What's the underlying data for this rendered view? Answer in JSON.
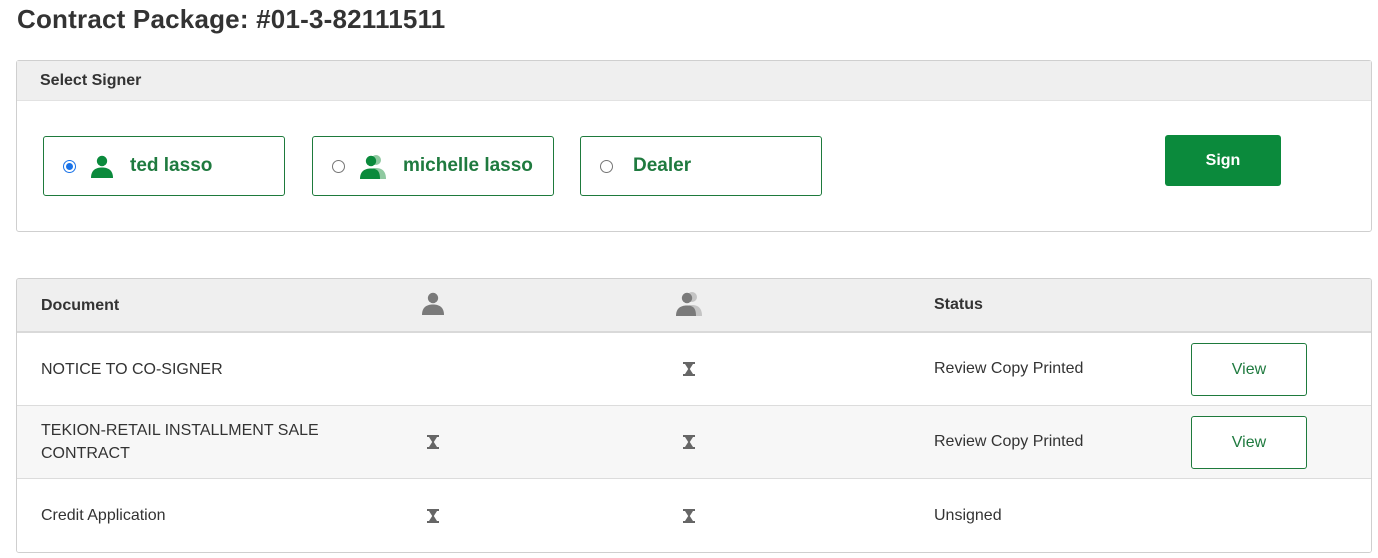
{
  "page": {
    "title": "Contract Package: #01-3-82111511"
  },
  "signer_panel": {
    "header": "Select Signer",
    "signers": [
      {
        "label": "ted lasso",
        "selected": true,
        "icon": "person-icon"
      },
      {
        "label": "michelle lasso",
        "selected": false,
        "icon": "person-co-signer-icon"
      },
      {
        "label": "Dealer",
        "selected": false,
        "icon": ""
      }
    ],
    "sign_button": "Sign"
  },
  "documents": {
    "columns": {
      "document": "Document",
      "signer1_icon": "person-icon",
      "signer2_icon": "person-co-signer-icon",
      "status": "Status"
    },
    "rows": [
      {
        "document": "NOTICE TO CO-SIGNER",
        "signer1": "",
        "signer2": "hourglass-icon",
        "status": "Review Copy Printed",
        "action": "View"
      },
      {
        "document": "TEKION-RETAIL INSTALLMENT SALE CONTRACT",
        "signer1": "hourglass-icon",
        "signer2": "hourglass-icon",
        "status": "Review Copy Printed",
        "action": "View"
      },
      {
        "document": "Credit Application",
        "signer1": "hourglass-icon",
        "signer2": "hourglass-icon",
        "status": "Unsigned",
        "action": ""
      }
    ]
  },
  "colors": {
    "accent_green": "#0b8a3c",
    "text_green": "#1f7a3f",
    "header_gray": "#efefef",
    "icon_gray": "#7a7a7a"
  }
}
